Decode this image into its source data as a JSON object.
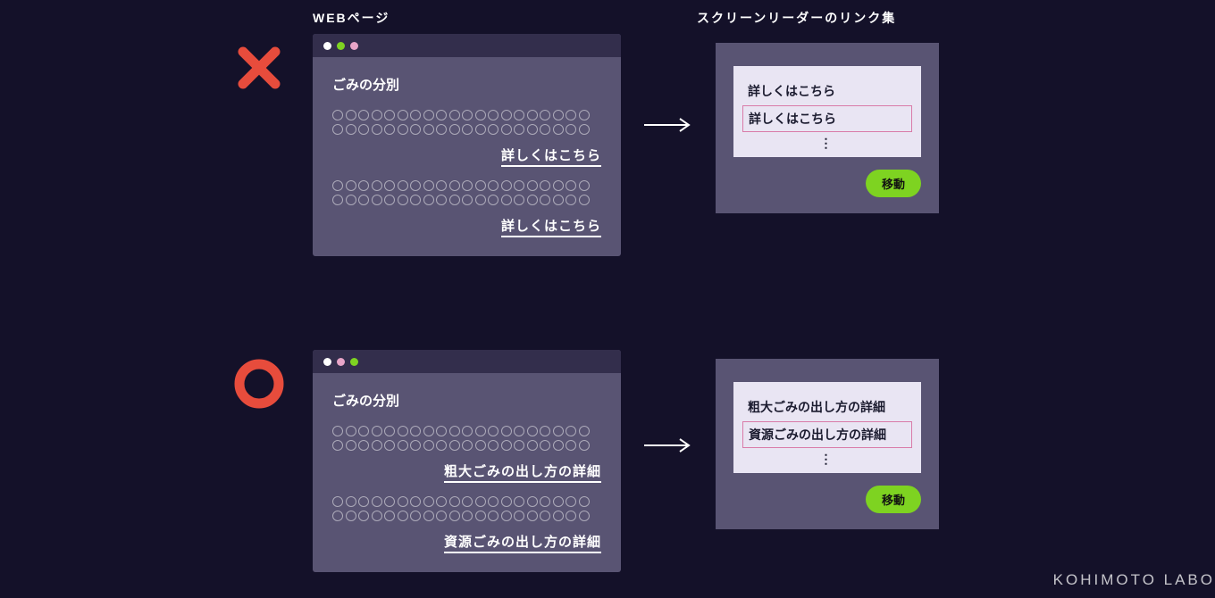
{
  "headers": {
    "left": "WEBページ",
    "right": "スクリーンリーダーのリンク集"
  },
  "bad": {
    "page_title": "ごみの分別",
    "link1": "詳しくはこちら",
    "link2": "詳しくはこちら",
    "sr_items": {
      "a": "詳しくはこちら",
      "b": "詳しくはこちら"
    },
    "dots": "⋮",
    "go": "移動"
  },
  "good": {
    "page_title": "ごみの分別",
    "link1": "粗大ごみの出し方の詳細",
    "link2": "資源ごみの出し方の詳細",
    "sr_items": {
      "a": "粗大ごみの出し方の詳細",
      "b": "資源ごみの出し方の詳細"
    },
    "dots": "⋮",
    "go": "移動"
  },
  "watermark": "KOHIMOTO LABO"
}
